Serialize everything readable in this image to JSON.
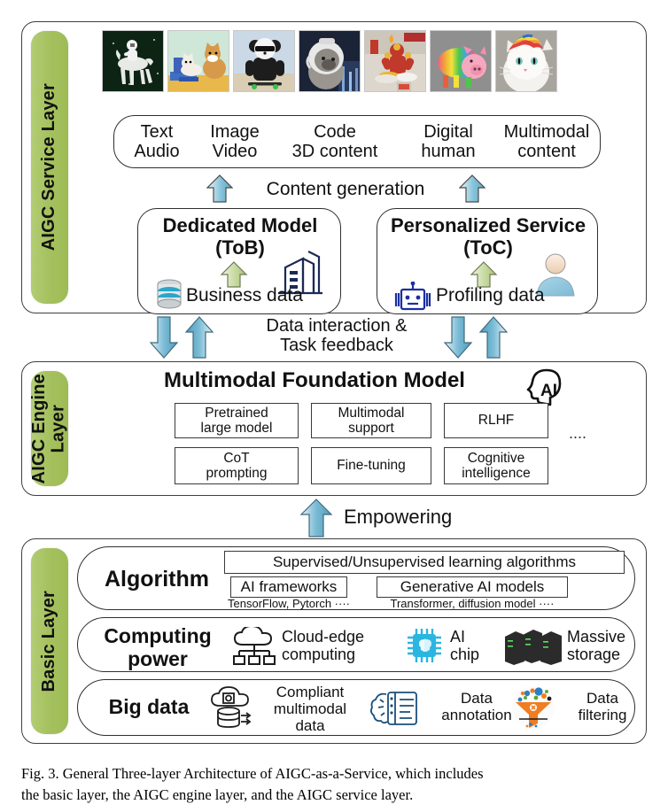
{
  "figure": {
    "caption_line1": "Fig. 3.   General Three-layer Architecture of AIGC-as-a-Service, which includes",
    "caption_line2": "the basic layer, the AIGC engine layer, and the AIGC service layer."
  },
  "colors": {
    "layer_tab_green": "#a6c260",
    "arrow_blue": "#5aa8c4",
    "arrow_green": "#b9cc8a",
    "border_dark": "#2f2f2f",
    "icon_cyan": "#2ab6e0",
    "icon_orange": "#f07d22",
    "icon_blue": "#1b3fa0"
  },
  "service_layer": {
    "tab_label": "AIGC Service Layer",
    "thumbnails": [
      {
        "name": "astronaut-riding-horse",
        "alt": "astronaut riding a white horse in space"
      },
      {
        "name": "cat-and-corgi-painting",
        "alt": "cat and corgi dog painting"
      },
      {
        "name": "panda-skateboarding",
        "alt": "panda in jacket with sunglasses on skateboard"
      },
      {
        "name": "raccoon-astronaut-helmet",
        "alt": "raccoon wearing astronaut helmet"
      },
      {
        "name": "iron-man-cooking",
        "alt": "iron man cooking in kitchen"
      },
      {
        "name": "rainbow-striped-pig",
        "alt": "rainbow striped pig"
      },
      {
        "name": "rainbow-hair-cat",
        "alt": "white cat with rainbow hair"
      }
    ],
    "content_types": [
      {
        "top": "Text",
        "bottom": "Audio"
      },
      {
        "top": "Image",
        "bottom": "Video"
      },
      {
        "top": "Code",
        "bottom": "3D content"
      },
      {
        "top": "Digital",
        "bottom": "human"
      },
      {
        "top": "Multimodal",
        "bottom": "content"
      }
    ],
    "content_generation_label": "Content generation",
    "dedicated_model": {
      "title_line1": "Dedicated Model",
      "title_line2": "(ToB)",
      "data_label": "Business data",
      "data_icon": "database-icon",
      "entity_icon": "office-building-icon"
    },
    "personalized_service": {
      "title_line1": "Personalized Service",
      "title_line2": "(ToC)",
      "data_label": "Profiling data",
      "data_icon": "robot-icon",
      "entity_icon": "user-person-icon"
    }
  },
  "interlayer_top": {
    "label_line1": "Data interaction &",
    "label_line2": "Task feedback"
  },
  "engine_layer": {
    "tab_label": "AIGC Engine\nLayer",
    "title": "Multimodal Foundation Model",
    "title_icon": "ai-head-icon",
    "capabilities_row1": [
      "Pretrained\nlarge model",
      "Multimodal\nsupport",
      "RLHF"
    ],
    "capabilities_row2": [
      "CoT\nprompting",
      "Fine-tuning",
      "Cognitive\nintelligence"
    ],
    "ellipsis": "...."
  },
  "interlayer_bottom": {
    "label": "Empowering"
  },
  "basic_layer": {
    "tab_label": "Basic Layer",
    "algorithm": {
      "title": "Algorithm",
      "top_box": "Supervised/Unsupervised learning algorithms",
      "left_box": "AI frameworks",
      "left_sub": "TensorFlow, Pytorch ····",
      "right_box": "Generative AI models",
      "right_sub": "Transformer,  diffusion model ····"
    },
    "computing": {
      "title_line1": "Computing",
      "title_line2": "power",
      "items": [
        {
          "label_line1": "Cloud-edge",
          "label_line2": "computing",
          "icon": "cloud-network-icon"
        },
        {
          "label_line1": "AI",
          "label_line2": "chip",
          "icon": "ai-chip-icon"
        },
        {
          "label_line1": "Massive",
          "label_line2": "storage",
          "icon": "server-rack-icon"
        }
      ]
    },
    "bigdata": {
      "title": "Big data",
      "items": [
        {
          "label_line1": "Compliant",
          "label_line2": "multimodal",
          "label_line3": "data",
          "icon": "cloud-database-icon"
        },
        {
          "label_line1": "Data",
          "label_line2": "annotation",
          "icon": "brain-document-icon"
        },
        {
          "label_line1": "Data",
          "label_line2": "filtering",
          "icon": "funnel-filter-icon"
        }
      ]
    }
  }
}
